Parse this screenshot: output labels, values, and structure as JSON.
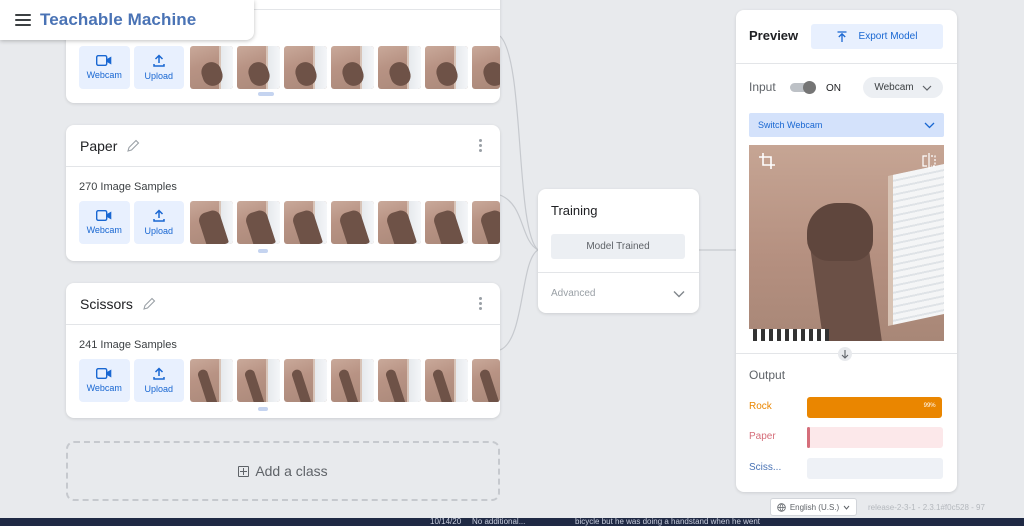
{
  "header": {
    "app_title": "Teachable Machine"
  },
  "classes": [
    {
      "name": "",
      "samples_label": "",
      "webcam_label": "Webcam",
      "upload_label": "Upload"
    },
    {
      "name": "Paper",
      "samples_label": "270 Image Samples",
      "webcam_label": "Webcam",
      "upload_label": "Upload"
    },
    {
      "name": "Scissors",
      "samples_label": "241 Image Samples",
      "webcam_label": "Webcam",
      "upload_label": "Upload"
    }
  ],
  "add_class": {
    "label": "Add a class"
  },
  "training": {
    "title": "Training",
    "button_label": "Model Trained",
    "advanced_label": "Advanced"
  },
  "preview": {
    "title": "Preview",
    "export_label": "Export Model",
    "input_label": "Input",
    "toggle_state": "ON",
    "source_select": "Webcam",
    "switch_webcam_label": "Switch Webcam",
    "output_label": "Output",
    "outputs": [
      {
        "label": "Rock",
        "percent_text": "99%",
        "value": 0.99,
        "color": "#ea8600",
        "track_color": "#ffffff"
      },
      {
        "label": "Paper",
        "percent_text": "",
        "value": 0.01,
        "color": "#d56e7a",
        "track_color": "#fce8ea"
      },
      {
        "label": "Sciss...",
        "percent_text": "",
        "value": 0.0,
        "color": "#4a73b5",
        "track_color": "#eef1f6"
      }
    ]
  },
  "footer": {
    "language": "English (U.S.)",
    "release": "release-2-3-1 - 2.3.1#f0c528 - 97"
  },
  "taskbar": {
    "date_text": "10/14/20",
    "note_text": "No additional...",
    "caption_text": "bicycle but he was doing a handstand when he went"
  },
  "colors": {
    "accent": "#1967d2",
    "brand": "#4a73b5",
    "background": "#e8eaed"
  }
}
